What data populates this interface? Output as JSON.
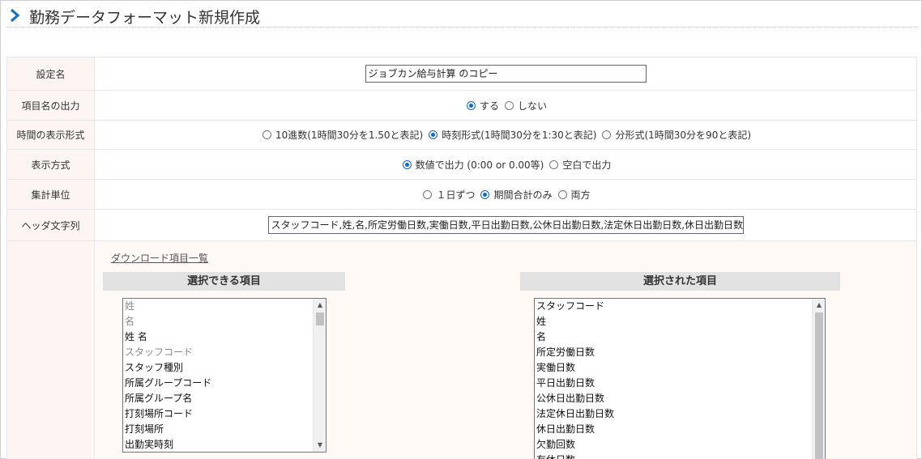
{
  "page": {
    "title": "勤務データフォーマット新規作成"
  },
  "form": {
    "setting_name": {
      "label": "設定名",
      "value": "ジョブカン給与計算 のコピー"
    },
    "item_name_output": {
      "label": "項目名の出力",
      "options": [
        "する",
        "しない"
      ],
      "selected": "する"
    },
    "time_format": {
      "label": "時間の表示形式",
      "options": [
        "10進数(1時間30分を1.50と表記)",
        "時刻形式(1時間30分を1:30と表記)",
        "分形式(1時間30分を90と表記)"
      ],
      "selected": "時刻形式(1時間30分を1:30と表記)"
    },
    "display_method": {
      "label": "表示方式",
      "options": [
        "数値で出力 (0:00 or 0.00等)",
        "空白で出力"
      ],
      "selected": "数値で出力 (0:00 or 0.00等)"
    },
    "aggregation_unit": {
      "label": "集計単位",
      "options": [
        "１日ずつ",
        "期間合計のみ",
        "両方"
      ],
      "selected": "期間合計のみ"
    },
    "header_string": {
      "label": "ヘッダ文字列",
      "value": "スタッフコード,姓,名,所定労働日数,実働日数,平日出勤日数,公休日出勤日数,法定休日出勤日数,休日出勤日数,"
    }
  },
  "download": {
    "link_label": "ダウンロード項目一覧",
    "available": {
      "header": "選択できる項目",
      "items": [
        "姓",
        "名",
        "姓 名",
        "スタッフコード",
        "スタッフ種別",
        "所属グループコード",
        "所属グループ名",
        "打刻場所コード",
        "打刻場所",
        "出勤実時刻"
      ],
      "dimmed": [
        true,
        true,
        false,
        true,
        false,
        false,
        false,
        false,
        false,
        false
      ]
    },
    "selected": {
      "header": "選択された項目",
      "items": [
        "スタッフコード",
        "姓",
        "名",
        "所定労働日数",
        "実働日数",
        "平日出勤日数",
        "公休日出勤日数",
        "法定休日出勤日数",
        "休日出勤日数",
        "欠勤回数",
        "有休日数"
      ]
    }
  },
  "colors": {
    "accent": "#0a66d8",
    "label_bg": "#fdf5f1",
    "header_bg": "#e2e2e2"
  }
}
